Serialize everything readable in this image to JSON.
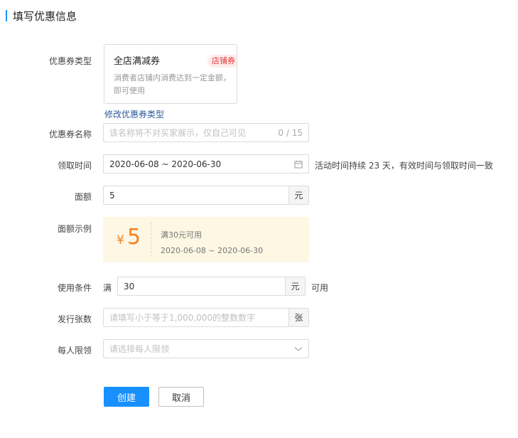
{
  "header": {
    "title": "填写优惠信息"
  },
  "coupon_type": {
    "label": "优惠券类型",
    "card_name": "全店满减券",
    "card_tag": "店铺券",
    "card_desc": "消费者店铺内消费达到一定金额，即可使用",
    "change_link": "修改优惠券类型"
  },
  "coupon_name": {
    "label": "优惠券名称",
    "placeholder": "该名称将不对买家展示，仅自己可见",
    "counter": "0 / 15"
  },
  "claim_time": {
    "label": "领取时间",
    "value": "2020-06-08 ~ 2020-06-30",
    "note": "活动时间持续 23 天，有效时间与领取时间一致"
  },
  "face_value": {
    "label": "面额",
    "value": "5",
    "unit": "元"
  },
  "preview": {
    "label": "面额示例",
    "currency": "¥",
    "amount": "5",
    "condition": "满30元可用",
    "date_range": "2020-06-08 ~ 2020-06-30"
  },
  "usage": {
    "label": "使用条件",
    "prefix": "满",
    "value": "30",
    "unit": "元",
    "suffix": "可用"
  },
  "quantity": {
    "label": "发行张数",
    "placeholder": "请填写小于等于1,000,000的整数数字",
    "unit": "张"
  },
  "limit": {
    "label": "每人限领",
    "placeholder": "请选择每人限领"
  },
  "actions": {
    "create": "创建",
    "cancel": "取消"
  },
  "colors": {
    "primary": "#1890ff",
    "accent_orange": "#f5821f",
    "tag_red": "#e4393c",
    "link": "#2d5b9c"
  }
}
